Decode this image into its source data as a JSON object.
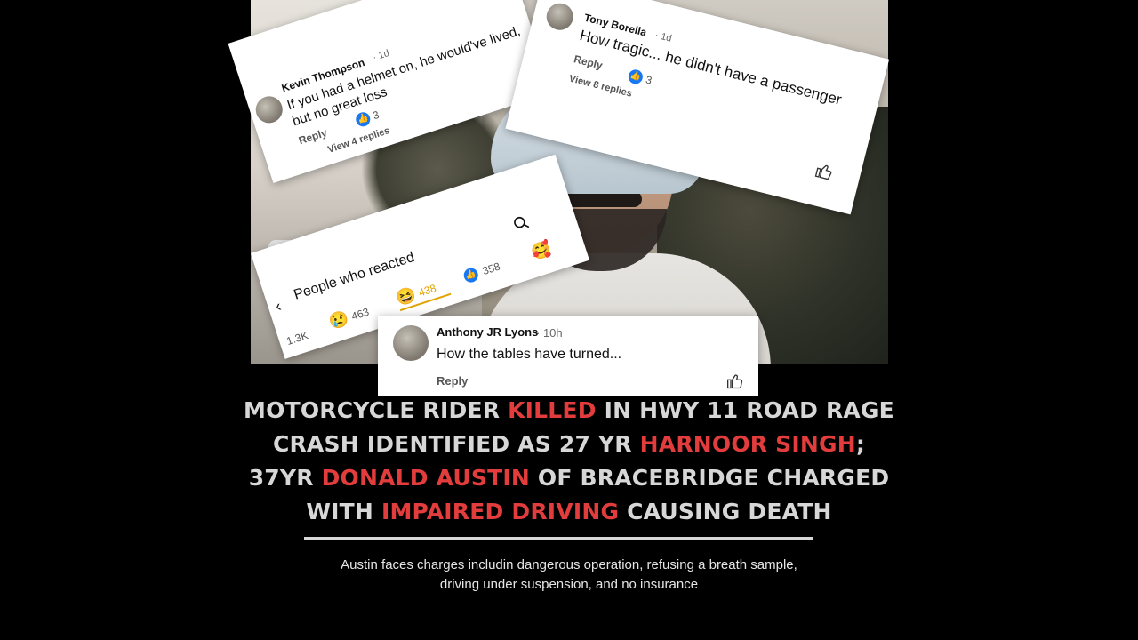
{
  "comments": {
    "kevin": {
      "name": "Kevin Thompson",
      "time": "· 1d",
      "text": "If you had a helmet on, he would've lived, but no great loss",
      "reply": "Reply",
      "likes": "3",
      "view": "View 4 replies"
    },
    "tony": {
      "name": "Tony Borella",
      "time": "· 1d",
      "text": "How tragic... he didn't have a passenger",
      "reply": "Reply",
      "likes": "3",
      "view": "View 8 replies"
    },
    "anthony": {
      "name": "Anthony JR Lyons",
      "time": "· 10h",
      "text": "How the tables have turned...",
      "reply": "Reply"
    }
  },
  "reactions": {
    "title": "People who reacted",
    "total": "1.3K",
    "sad_count": "463",
    "haha_count": "438",
    "like_count": "358"
  },
  "headline": {
    "l1a": "MOTORCYCLE RIDER ",
    "l1b": "KILLED",
    "l1c": " IN HWY 11 ROAD RAGE",
    "l2a": "CRASH IDENTIFIED AS 27 YR ",
    "l2b": "HARNOOR SINGH",
    "l2c": ";",
    "l3a": "37YR ",
    "l3b": "DONALD AUSTIN",
    "l3c": " OF BRACEBRIDGE CHARGED",
    "l4a": "WITH ",
    "l4b": "IMPAIRED DRIVING",
    "l4c": " CAUSING DEATH"
  },
  "divider": "——————————————————————————",
  "subtext": {
    "line1": "Austin faces charges includin dangerous operation,  refusing a breath sample,",
    "line2": "driving under suspension, and no insurance"
  },
  "colors": {
    "accent_red": "#e23c3c",
    "facebook_blue": "#1877f2",
    "headline_gray": "#d7d7d7"
  }
}
